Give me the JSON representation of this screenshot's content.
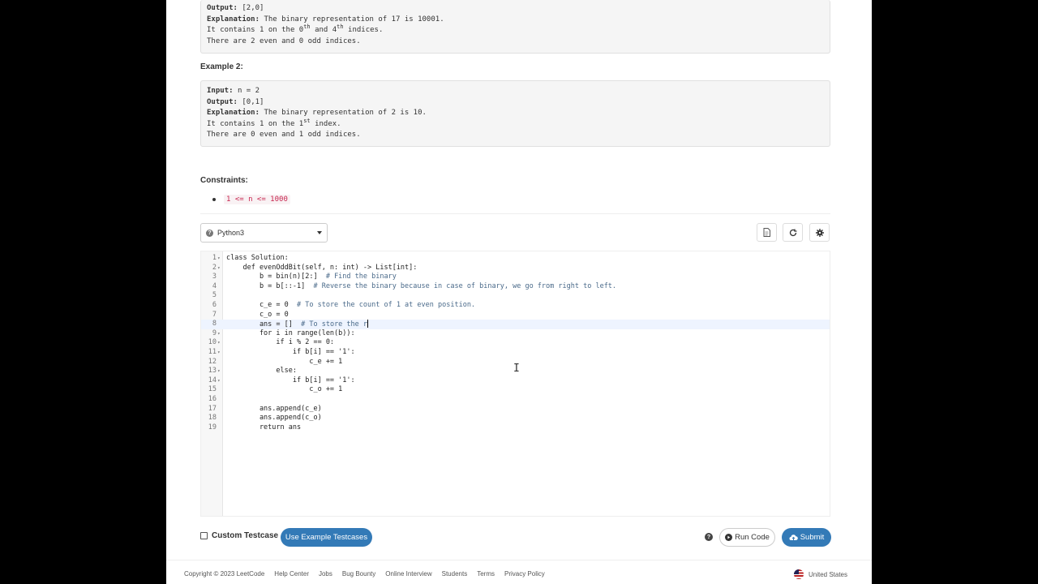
{
  "example1": {
    "output_label": "Output:",
    "output_value": "[2,0]",
    "explanation_label": "Explanation:",
    "explanation_text": "The binary representation of 17 is 10001.",
    "line2_a": "It contains 1 on the 0",
    "line2_sup1": "th",
    "line2_b": " and 4",
    "line2_sup2": "th",
    "line2_c": " indices.",
    "line3": "There are 2 even and 0 odd indices."
  },
  "example2": {
    "heading": "Example 2:",
    "input_label": "Input:",
    "input_value": "n = 2",
    "output_label": "Output:",
    "output_value": "[0,1]",
    "explanation_label": "Explanation:",
    "explanation_text": "The binary representation of 2 is 10.",
    "line2_a": "It contains 1 on the 1",
    "line2_sup": "st",
    "line2_b": " index.",
    "line3": "There are 0 even and 1 odd indices."
  },
  "constraints": {
    "heading": "Constraints:",
    "item": "1 <= n <= 1000"
  },
  "toolbar": {
    "language": "Python3",
    "icons": [
      "document-icon",
      "refresh-icon",
      "settings-icon"
    ]
  },
  "editor": {
    "lines": [
      {
        "n": "1",
        "fold": "▾",
        "code": "class Solution:",
        "comment": ""
      },
      {
        "n": "2",
        "fold": "▾",
        "code": "    def evenOddBit(self, n: int) -> List[int]:",
        "comment": ""
      },
      {
        "n": "3",
        "fold": "",
        "code": "        b = bin(n)[2:]  ",
        "comment": "# Find the binary"
      },
      {
        "n": "4",
        "fold": "",
        "code": "        b = b[::-1]  ",
        "comment": "# Reverse the binary because in case of binary, we go from right to left."
      },
      {
        "n": "5",
        "fold": "",
        "code": "",
        "comment": ""
      },
      {
        "n": "6",
        "fold": "",
        "code": "        c_e = 0  ",
        "comment": "# To store the count of 1 at even position."
      },
      {
        "n": "7",
        "fold": "",
        "code": "        c_o = 0",
        "comment": ""
      },
      {
        "n": "8",
        "fold": "",
        "code": "        ans = []  ",
        "comment": "# To store the r"
      },
      {
        "n": "9",
        "fold": "▾",
        "code": "        for i in range(len(b)):",
        "comment": ""
      },
      {
        "n": "10",
        "fold": "▾",
        "code": "            if i % 2 == 0:",
        "comment": ""
      },
      {
        "n": "11",
        "fold": "▾",
        "code": "                if b[i] == '1':",
        "comment": ""
      },
      {
        "n": "12",
        "fold": "",
        "code": "                    c_e += 1",
        "comment": ""
      },
      {
        "n": "13",
        "fold": "▾",
        "code": "            else:",
        "comment": ""
      },
      {
        "n": "14",
        "fold": "▾",
        "code": "                if b[i] == '1':",
        "comment": ""
      },
      {
        "n": "15",
        "fold": "",
        "code": "                    c_o += 1",
        "comment": ""
      },
      {
        "n": "16",
        "fold": "",
        "code": "",
        "comment": ""
      },
      {
        "n": "17",
        "fold": "",
        "code": "        ans.append(c_e)",
        "comment": ""
      },
      {
        "n": "18",
        "fold": "",
        "code": "        ans.append(c_o)",
        "comment": ""
      },
      {
        "n": "19",
        "fold": "",
        "code": "        return ans",
        "comment": ""
      }
    ],
    "active_line": 8
  },
  "bottom_bar": {
    "custom_testcase_label": "Custom Testcase",
    "use_example_label": "Use Example Testcases",
    "run_code_label": "Run Code",
    "submit_label": "Submit"
  },
  "footer": {
    "copyright": "Copyright © 2023 LeetCode",
    "links": [
      "Help Center",
      "Jobs",
      "Bug Bounty",
      "Online Interview",
      "Students",
      "Terms",
      "Privacy Policy"
    ],
    "country": "United States"
  }
}
